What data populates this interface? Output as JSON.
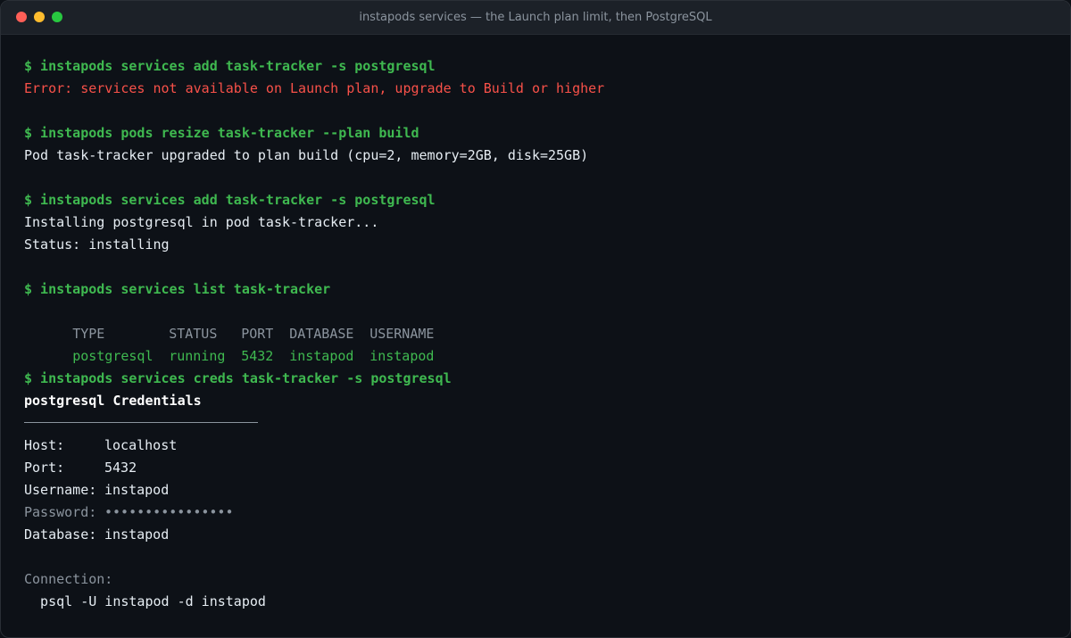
{
  "window": {
    "title": "instapods services — the Launch plan limit, then PostgreSQL",
    "lights": {
      "close": "#ff5f57",
      "minimize": "#febc2e",
      "maximize": "#28c840"
    }
  },
  "colors": {
    "background": "#0d1117",
    "command": "#3fb950",
    "error": "#f85149",
    "dim": "#8b949e",
    "text": "#e6edf3"
  },
  "terminal": {
    "block1": {
      "command": "$ instapods services add task-tracker -s postgresql",
      "error": "Error: services not available on Launch plan, upgrade to Build or higher"
    },
    "block2": {
      "command": "$ instapods pods resize task-tracker --plan build",
      "output": "Pod task-tracker upgraded to plan build (cpu=2, memory=2GB, disk=25GB)"
    },
    "block3": {
      "command": "$ instapods services add task-tracker -s postgresql",
      "output1": "Installing postgresql in pod task-tracker...",
      "output2": "Status: installing"
    },
    "block4": {
      "command": "$ instapods services list task-tracker",
      "headers": [
        "TYPE",
        "STATUS",
        "PORT",
        "DATABASE",
        "USERNAME"
      ],
      "rows": [
        [
          "postgresql",
          "running",
          "5432",
          "instapod",
          "instapod"
        ]
      ]
    },
    "block5": {
      "command": "$ instapods services creds task-tracker -s postgresql",
      "heading": "postgresql Credentials",
      "host_label": "Host:",
      "host_value": "localhost",
      "port_label": "Port:",
      "port_value": "5432",
      "username_label": "Username:",
      "username_value": "instapod",
      "password_label": "Password:",
      "password_value": "••••••••••••••••",
      "database_label": "Database:",
      "database_value": "instapod",
      "connection_label": "Connection:",
      "connection_value": "  psql -U instapod -d instapod"
    }
  }
}
